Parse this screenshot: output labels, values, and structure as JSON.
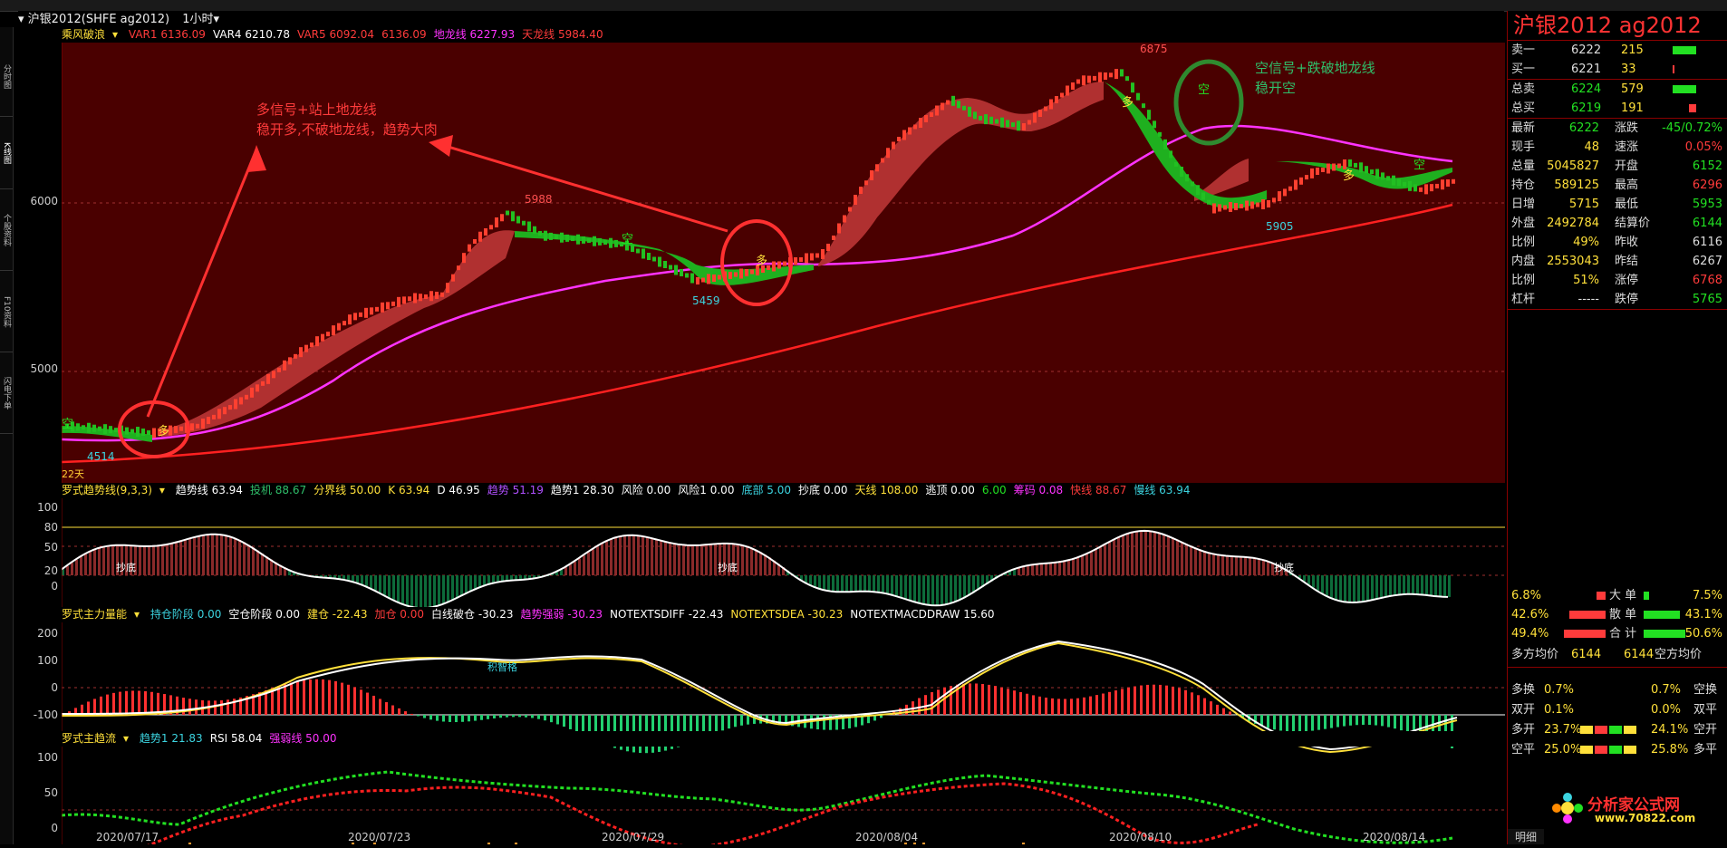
{
  "window": {
    "title": "沪银2012(SHFE ag2012)",
    "period": "1小时"
  },
  "left_tabs": [
    "分时图",
    "K线图",
    "个股资料",
    "F10资料",
    "闪电下单"
  ],
  "main_chart": {
    "indicator": {
      "name": "乘风破浪",
      "items": [
        {
          "label": "VAR1",
          "value": "6136.09",
          "color": "#ff3b3b"
        },
        {
          "label": "VAR4",
          "value": "6210.78",
          "color": "#ffffff"
        },
        {
          "label": "VAR5",
          "value": "6092.04",
          "color": "#ff3b3b"
        },
        {
          "label": "",
          "value": "6136.09",
          "color": "#ff3b3b"
        },
        {
          "label": "地龙线",
          "value": "6227.93",
          "color": "#ff33ff"
        },
        {
          "label": "天龙线",
          "value": "5984.40",
          "color": "#ff3b3b"
        }
      ]
    },
    "y_ticks": [
      "6000",
      "5000"
    ],
    "price_labels": [
      "6875",
      "5988",
      "5459",
      "5905",
      "4514"
    ],
    "day_label": "22天",
    "annotation_long": {
      "line1": "多信号+站上地龙线",
      "line2": "稳开多,不破地龙线，趋势大肉"
    },
    "annotation_short": {
      "line1": "空信号+跌破地龙线",
      "line2": "稳开空"
    },
    "signals": {
      "long": "多",
      "short": "空"
    }
  },
  "ind1": {
    "name": "罗式趋势线(9,3,3)",
    "items": [
      {
        "label": "趋势线",
        "value": "63.94",
        "color": "#ffffff"
      },
      {
        "label": "投机",
        "value": "88.67",
        "color": "#2fbf6a"
      },
      {
        "label": "分界线",
        "value": "50.00",
        "color": "#ffe03a"
      },
      {
        "label": "K",
        "value": "63.94",
        "color": "#ffe03a"
      },
      {
        "label": "D",
        "value": "46.95",
        "color": "#ffffff"
      },
      {
        "label": "趋势",
        "value": "51.19",
        "color": "#b050ff"
      },
      {
        "label": "趋势1",
        "value": "28.30",
        "color": "#ffffff"
      },
      {
        "label": "风险",
        "value": "0.00",
        "color": "#ffffff"
      },
      {
        "label": "风险1",
        "value": "0.00",
        "color": "#ffffff"
      },
      {
        "label": "底部",
        "value": "5.00",
        "color": "#3cd4e0"
      },
      {
        "label": "抄底",
        "value": "0.00",
        "color": "#ffffff"
      },
      {
        "label": "天线",
        "value": "108.00",
        "color": "#ffe03a"
      },
      {
        "label": "逃顶",
        "value": "0.00",
        "color": "#ffffff"
      },
      {
        "label": "",
        "value": "6.00",
        "color": "#22e022"
      },
      {
        "label": "筹码",
        "value": "0.08",
        "color": "#ff33ff"
      },
      {
        "label": "快线",
        "value": "88.67",
        "color": "#ff3b3b"
      },
      {
        "label": "慢线",
        "value": "63.94",
        "color": "#3cd4e0"
      }
    ],
    "y_ticks": [
      "100",
      "80",
      "50",
      "20",
      "0"
    ],
    "labels": [
      "抄底",
      "抄底",
      "抄底"
    ]
  },
  "ind2": {
    "name": "罗式主力量能",
    "items": [
      {
        "label": "持仓阶段",
        "value": "0.00",
        "color": "#3cd4e0"
      },
      {
        "label": "空仓阶段",
        "value": "0.00",
        "color": "#ffffff"
      },
      {
        "label": "建仓",
        "value": "-22.43",
        "color": "#ffe03a"
      },
      {
        "label": "加仓",
        "value": "0.00",
        "color": "#ff3b3b"
      },
      {
        "label": "白线破仓",
        "value": "-30.23",
        "color": "#ffffff"
      },
      {
        "label": "趋势强弱",
        "value": "-30.23",
        "color": "#ff33ff"
      },
      {
        "label": "NOTEXTSDIFF",
        "value": "-22.43",
        "color": "#ffffff"
      },
      {
        "label": "NOTEXTSDEA",
        "value": "-30.23",
        "color": "#ffe03a"
      },
      {
        "label": "NOTEXTMACDDRAW",
        "value": "15.60",
        "color": "#ffffff"
      }
    ],
    "y_ticks": [
      "200",
      "100",
      "0",
      "-100"
    ],
    "label": "积智格"
  },
  "ind3": {
    "name": "罗式主趋流",
    "items": [
      {
        "label": "趋势1",
        "value": "21.83",
        "color": "#3cd4e0"
      },
      {
        "label": "RSI",
        "value": "58.04",
        "color": "#ffffff"
      },
      {
        "label": "强弱线",
        "value": "50.00",
        "color": "#ff33ff"
      }
    ],
    "y_ticks": [
      "100",
      "50",
      "0"
    ]
  },
  "x_axis": [
    "2020/07/17",
    "2020/07/23",
    "2020/07/29",
    "2020/08/04",
    "2020/08/10",
    "2020/08/14"
  ],
  "quote": {
    "title": "沪银2012  ag2012",
    "asks": [
      {
        "label": "卖一",
        "price": "6222",
        "vol": "215"
      }
    ],
    "bids": [
      {
        "label": "买一",
        "price": "6221",
        "vol": "33"
      }
    ],
    "total_sell": {
      "label": "总卖",
      "price": "6224",
      "vol": "579"
    },
    "total_buy": {
      "label": "总买",
      "price": "6219",
      "vol": "191"
    },
    "left": [
      {
        "label": "最新",
        "value": "6222",
        "cls": "g"
      },
      {
        "label": "现手",
        "value": "48",
        "cls": "y"
      },
      {
        "label": "总量",
        "value": "5045827",
        "cls": "y"
      },
      {
        "label": "持仓",
        "value": "589125",
        "cls": "y"
      },
      {
        "label": "日增",
        "value": "5715",
        "cls": "y"
      },
      {
        "label": "外盘",
        "value": "2492784",
        "cls": "y"
      },
      {
        "label": "比例",
        "value": "49%",
        "cls": "y"
      },
      {
        "label": "内盘",
        "value": "2553043",
        "cls": "y"
      },
      {
        "label": "比例",
        "value": "51%",
        "cls": "y"
      },
      {
        "label": "杠杆",
        "value": "-----",
        "cls": "w"
      }
    ],
    "right": [
      {
        "label": "涨跌",
        "value": "-45/0.72%",
        "cls": "g"
      },
      {
        "label": "速涨",
        "value": "0.05%",
        "cls": "r"
      },
      {
        "label": "开盘",
        "value": "6152",
        "cls": "g"
      },
      {
        "label": "最高",
        "value": "6296",
        "cls": "r"
      },
      {
        "label": "最低",
        "value": "5953",
        "cls": "g"
      },
      {
        "label": "结算价",
        "value": "6144",
        "cls": "g"
      },
      {
        "label": "昨收",
        "value": "6116",
        "cls": "w"
      },
      {
        "label": "昨结",
        "value": "6267",
        "cls": "w"
      },
      {
        "label": "涨停",
        "value": "6768",
        "cls": "r"
      },
      {
        "label": "跌停",
        "value": "5765",
        "cls": "g"
      }
    ],
    "flows": [
      {
        "l": "6.8%",
        "label": "大 单",
        "r": "7.5%"
      },
      {
        "l": "42.6%",
        "label": "散 单",
        "r": "43.1%"
      },
      {
        "l": "49.4%",
        "label": "合 计",
        "r": "50.6%"
      }
    ],
    "avg": {
      "left_label": "多方均价",
      "left_val": "6144",
      "right_val": "6144",
      "right_label": "空方均价"
    },
    "positions": [
      {
        "l_label": "多换",
        "l_val": "0.7%",
        "r_val": "0.7%",
        "r_label": "空换"
      },
      {
        "l_label": "双开",
        "l_val": "0.1%",
        "r_val": "0.0%",
        "r_label": "双平"
      },
      {
        "l_label": "多开",
        "l_val": "23.7%",
        "r_val": "24.1%",
        "r_label": "空开"
      },
      {
        "l_label": "空平",
        "l_val": "25.0%",
        "r_val": "25.8%",
        "r_label": "多平"
      }
    ],
    "watermark": {
      "name": "分析家公式网",
      "url": "www.70822.com"
    },
    "bottom_tab": "明细"
  }
}
